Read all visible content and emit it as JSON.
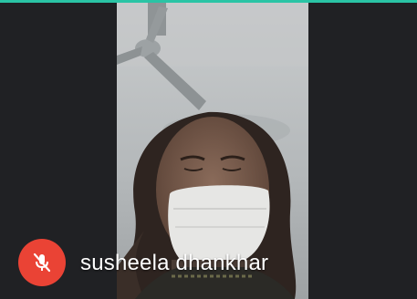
{
  "participant": {
    "name": "susheela dhankhar",
    "mic_status_icon": "mic-off-icon"
  },
  "colors": {
    "background": "#202124",
    "accent": "#2ac4a5",
    "mic_off": "#ea4335",
    "label_text": "#ffffff"
  }
}
